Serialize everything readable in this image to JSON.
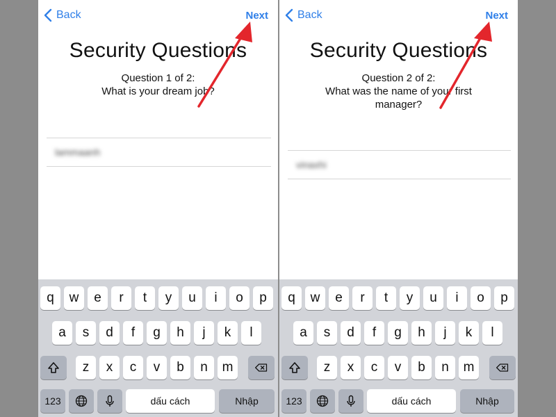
{
  "colors": {
    "accent": "#2f7fe8",
    "arrow": "#e3262c",
    "keyboard_bg": "#d2d4d9",
    "key_func": "#aeb3bd"
  },
  "screens": [
    {
      "back_label": "Back",
      "next_label": "Next",
      "title": "Security Questions",
      "question_line1": "Question 1 of 2:",
      "question_line2": "What is your dream job?",
      "answer_value": "lammaanh"
    },
    {
      "back_label": "Back",
      "next_label": "Next",
      "title": "Security Questions",
      "question_line1": "Question 2 of 2:",
      "question_line2": "What was the name of your first manager?",
      "answer_value": "vinaxhi"
    }
  ],
  "keyboard": {
    "row1": [
      "q",
      "w",
      "e",
      "r",
      "t",
      "y",
      "u",
      "i",
      "o",
      "p"
    ],
    "row2": [
      "a",
      "s",
      "d",
      "f",
      "g",
      "h",
      "j",
      "k",
      "l"
    ],
    "row3": [
      "z",
      "x",
      "c",
      "v",
      "b",
      "n",
      "m"
    ],
    "numbers_key": "123",
    "space_key": "dấu cách",
    "return_key": "Nhập",
    "icons": {
      "shift": "shift-icon",
      "delete": "delete-icon",
      "globe": "globe-icon",
      "mic": "microphone-icon"
    }
  }
}
